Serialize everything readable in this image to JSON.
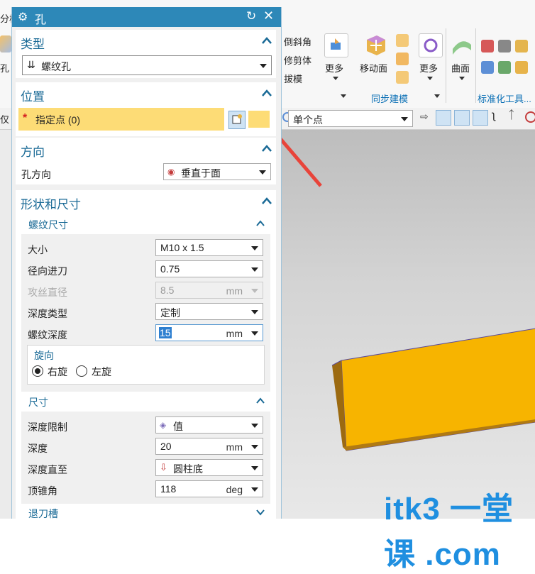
{
  "ribbon": {
    "left_partial_label": "分析",
    "left_partial_label2": "孔",
    "items": [
      "倒斜角",
      "修剪体",
      "拔模"
    ],
    "more1": "更多",
    "move_face": "移动面",
    "more2": "更多",
    "surface": "曲面",
    "group_sync": "同步建模",
    "group_std": "标准化工具..."
  },
  "selection_bar": {
    "left_partial": "仅",
    "point_mode": "单个点"
  },
  "dialog": {
    "title": "孔",
    "type": {
      "header": "类型",
      "value": "螺纹孔"
    },
    "position": {
      "header": "位置",
      "specify_point": "指定点 (0)",
      "required_mark": "*"
    },
    "direction": {
      "header": "方向",
      "label": "孔方向",
      "value": "垂直于面"
    },
    "shape": {
      "header": "形状和尺寸",
      "thread": {
        "header": "螺纹尺寸",
        "size_label": "大小",
        "size_value": "M10 x 1.5",
        "radial_label": "径向进刀",
        "radial_value": "0.75",
        "tap_label": "攻丝直径",
        "tap_value": "8.5",
        "tap_unit": "mm",
        "depth_type_label": "深度类型",
        "depth_type_value": "定制",
        "thread_depth_label": "螺纹深度",
        "thread_depth_value": "15",
        "thread_depth_unit": "mm",
        "rotation": {
          "header": "旋向",
          "right": "右旋",
          "left": "左旋",
          "selected": "right"
        }
      },
      "dimensions": {
        "header": "尺寸",
        "limit_label": "深度限制",
        "limit_value": "值",
        "depth_label": "深度",
        "depth_value": "20",
        "depth_unit": "mm",
        "depth_to_label": "深度直至",
        "depth_to_value": "圆柱底",
        "tip_label": "顶锥角",
        "tip_value": "118",
        "tip_unit": "deg"
      },
      "relief": {
        "header": "退刀槽"
      }
    }
  },
  "watermark": "itk3 一堂课 .com",
  "colors": {
    "titlebar": "#2d88b8",
    "highlight": "#fddc76",
    "accent_text": "#1a6a96",
    "block": "#f7b400",
    "arrow": "#e8443a"
  }
}
